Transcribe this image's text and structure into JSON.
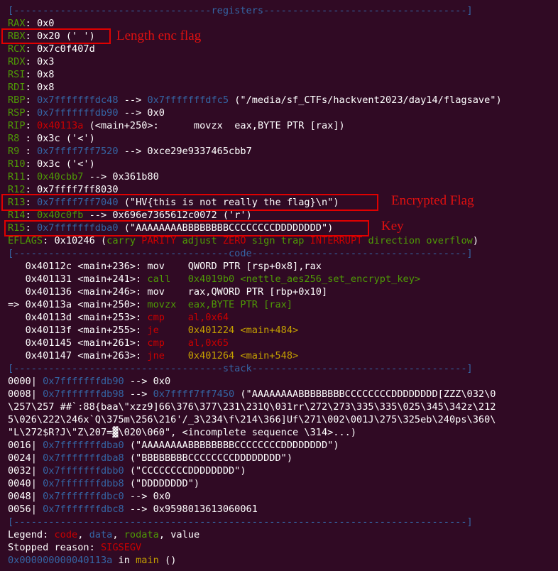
{
  "registers": {
    "separator": "[----------------------------------registers-----------------------------------]",
    "rax": {
      "name": "RAX",
      "value": "0x0"
    },
    "rbx": {
      "name": "RBX",
      "value": "0x20 (' ')"
    },
    "rcx": {
      "name": "RCX",
      "value": "0x7c0f407d"
    },
    "rdx": {
      "name": "RDX",
      "value": "0x3"
    },
    "rsi": {
      "name": "RSI",
      "value": "0x8"
    },
    "rdi": {
      "name": "RDI",
      "value": "0x8"
    },
    "rbp": {
      "name": "RBP",
      "addr": "0x7fffffffdc48",
      "arrow": " --> ",
      "addr2": "0x7fffffffdfc5",
      "rest": " (\"/media/sf_CTFs/hackvent2023/day14/flagsave\")"
    },
    "rsp": {
      "name": "RSP",
      "addr": "0x7fffffffdb90",
      "rest": " --> 0x0"
    },
    "rip": {
      "name": "RIP",
      "addr": "0x40113a",
      "rest": " (<main+250>:      movzx  eax,BYTE PTR [rax])"
    },
    "r8": {
      "name": "R8 ",
      "value": "0x3c ('<')"
    },
    "r9": {
      "name": "R9 ",
      "addr": "0x7ffff7ff7520",
      "rest": " --> 0xce29e9337465cbb7"
    },
    "r10": {
      "name": "R10",
      "value": "0x3c ('<')"
    },
    "r11": {
      "name": "R11",
      "addr": "0x40cbb7",
      "rest": " --> 0x361b80"
    },
    "r12": {
      "name": "R12",
      "value": "0x7ffff7ff8030"
    },
    "r13": {
      "name": "R13",
      "addr": "0x7ffff7ff7040",
      "rest": " (\"HV{this is not really the flag}\\n\")"
    },
    "r14": {
      "name": "R14",
      "addr": "0x40c0fb",
      "rest": " --> 0x696e7365612c0072 ('r')"
    },
    "r15": {
      "name": "R15",
      "addr": "0x7fffffffdba0",
      "rest": " (\"AAAAAAAABBBBBBBBCCCCCCCCDDDDDDDD\")"
    },
    "eflags": {
      "name": "EFLAGS",
      "value": "0x10246",
      "open": " (",
      "carry": "carry",
      "parity": "PARITY",
      "adjust": "adjust",
      "zero": "ZERO",
      "sign": "sign",
      "trap": "trap",
      "interrupt": "INTERRUPT",
      "direction": "direction",
      "overflow": "overflow",
      "close": ")"
    }
  },
  "code": {
    "separator": "[-------------------------------------code-------------------------------------]",
    "lines": [
      {
        "prefix": "   ",
        "addr": "0x40112c <main+236>:",
        "mnem": " mov    ",
        "ops": "QWORD PTR [rsp+0x8],rax"
      },
      {
        "prefix": "   ",
        "addr": "0x401131 <main+241>:",
        "mnem": " call   ",
        "ops": "0x4019b0 <nettle_aes256_set_encrypt_key>"
      },
      {
        "prefix": "   ",
        "addr": "0x401136 <main+246>:",
        "mnem": " mov    ",
        "ops": "rax,QWORD PTR [rbp+0x10]"
      },
      {
        "prefix": "=> ",
        "addr": "0x40113a <main+250>:",
        "mnem": " movzx  ",
        "ops": "eax,BYTE PTR [rax]"
      },
      {
        "prefix": "   ",
        "addr": "0x40113d <main+253>:",
        "mnem": " cmp    ",
        "ops": "al,0x64"
      },
      {
        "prefix": "   ",
        "addr": "0x40113f <main+255>:",
        "mnem": " je     ",
        "ops": "0x401224 <main+484>"
      },
      {
        "prefix": "   ",
        "addr": "0x401145 <main+261>:",
        "mnem": " cmp    ",
        "ops": "al,0x65"
      },
      {
        "prefix": "   ",
        "addr": "0x401147 <main+263>:",
        "mnem": " jne    ",
        "ops": "0x401264 <main+548>"
      }
    ]
  },
  "stack": {
    "separator": "[------------------------------------stack-------------------------------------]",
    "lines": [
      {
        "off": "0000| ",
        "addr": "0x7fffffffdb90",
        "rest": " --> 0x0"
      },
      {
        "off": "0008| ",
        "addr": "0x7fffffffdb98",
        "arrow": " --> ",
        "addr2": "0x7ffff7ff7450",
        "rest": " (\"AAAAAAAABBBBBBBBCCCCCCCCDDDDDDDD[ZZZ\\032\\0"
      },
      {
        "cont": "\\257\\257 ##`:88{baa\\\"xzz9]66\\376\\377\\231\\231Q\\031rr\\272\\273\\335\\335\\025\\345\\342z\\212"
      },
      {
        "cont": "5\\026\\222\\246x`Q\\375m\\256\\216'/_3\\234\\f\\214\\366]Uf\\271\\002\\001J\\275\\325eb\\240ps\\360\\"
      },
      {
        "cont": "\"L\\272$R?J\\\"Z\\207=▓\\020\\060\", <incomplete sequence \\314>...)"
      },
      {
        "off": "0016| ",
        "addr": "0x7fffffffdba0",
        "rest": " (\"AAAAAAAABBBBBBBBCCCCCCCCDDDDDDDD\")"
      },
      {
        "off": "0024| ",
        "addr": "0x7fffffffdba8",
        "rest": " (\"BBBBBBBBCCCCCCCCDDDDDDDD\")"
      },
      {
        "off": "0032| ",
        "addr": "0x7fffffffdbb0",
        "rest": " (\"CCCCCCCCDDDDDDDD\")"
      },
      {
        "off": "0040| ",
        "addr": "0x7fffffffdbb8",
        "rest": " (\"DDDDDDDD\")"
      },
      {
        "off": "0048| ",
        "addr": "0x7fffffffdbc0",
        "rest": " --> 0x0"
      },
      {
        "off": "0056| ",
        "addr": "0x7fffffffdbc8",
        "rest": " --> 0x9598013613060061"
      }
    ]
  },
  "footer": {
    "separator": "[------------------------------------------------------------------------------]",
    "legend_label": "Legend: ",
    "legend_code": "code",
    "comma1": ", ",
    "legend_data": "data",
    "comma2": ", ",
    "legend_rodata": "rodata",
    "comma3": ", ",
    "legend_value": "value",
    "stopped_label": "Stopped reason: ",
    "stopped_value": "SIGSEGV",
    "location_addr": "0x000000000040113a",
    "location_in": " in ",
    "location_func": "main",
    "location_rest": " ()"
  },
  "annotations": {
    "rbx": "Length enc flag",
    "r13": "Encrypted Flag",
    "r15": "Key"
  },
  "colors": {
    "background": "#300a24",
    "register_name": "#4e9a06",
    "code": "#cc0000",
    "data": "#3465a4",
    "rodata": "#c4a000",
    "annotation": "#e01010"
  }
}
